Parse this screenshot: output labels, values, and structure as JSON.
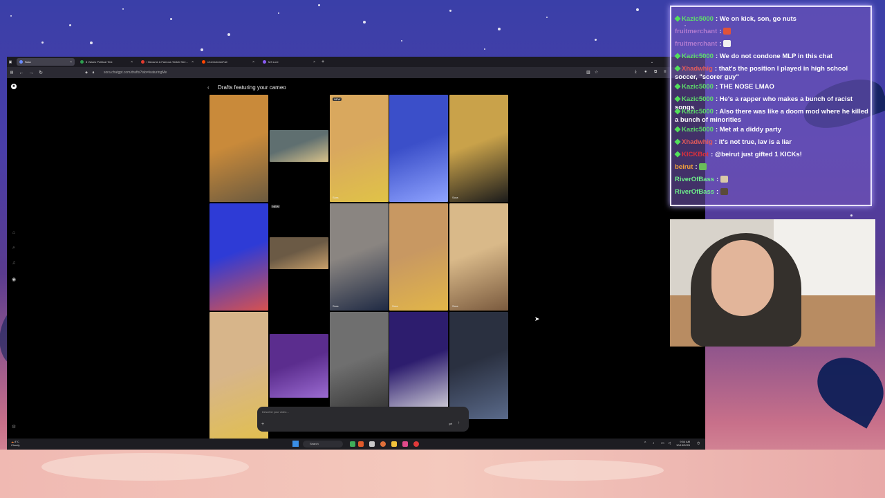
{
  "browser": {
    "tabs": [
      {
        "label": "Sora",
        "color": "#6b8cff",
        "active": true
      },
      {
        "label": "8 Values Political Test",
        "color": "#2e9e4f",
        "active": false
      },
      {
        "label": "I Became A Famous Twitch Stre...",
        "color": "#e23b2f",
        "active": false
      },
      {
        "label": "r/LivestreamFail",
        "color": "#ff4500",
        "active": false
      },
      {
        "label": "M3 Lore",
        "color": "#8b5cf6",
        "active": false
      }
    ],
    "new_tab": "+",
    "url": "sora.chatgpt.com/drafts?tab=featuringMe"
  },
  "sora": {
    "back": "‹",
    "title": "Drafts featuring your cameo",
    "sora_label": "Sora",
    "new_label": "NEW",
    "prompt_placeholder": "Describe your video...",
    "prompt_plus": "+",
    "prompt_settings": "⇌",
    "prompt_send": "↑",
    "thumbs": [
      {
        "colors": [
          "#c98a3a",
          "#6b5a3f"
        ],
        "new": false,
        "sora": false
      },
      {
        "colors": [
          "#5f6f70",
          "#d8c28a"
        ],
        "new": false,
        "sora": false
      },
      {
        "colors": [
          "#d9a85e",
          "#e0c347"
        ],
        "new": true,
        "sora": true
      },
      {
        "colors": [
          "#3b4fc9",
          "#8fa3ff"
        ],
        "new": false,
        "sora": false
      },
      {
        "colors": [
          "#c9a24a",
          "#1b1b1b"
        ],
        "new": false,
        "sora": true
      },
      {
        "colors": [
          "#2e3bd6",
          "#d8524f"
        ],
        "new": false,
        "sora": false
      },
      {
        "colors": [
          "#6b5a45",
          "#c9a06a"
        ],
        "new": true,
        "sora": false
      },
      {
        "colors": [
          "#8a8581",
          "#1f2a44"
        ],
        "new": false,
        "sora": true
      },
      {
        "colors": [
          "#c89862",
          "#e2b648"
        ],
        "new": false,
        "sora": true
      },
      {
        "colors": [
          "#d9b989",
          "#7a5a3e"
        ],
        "new": false,
        "sora": true
      },
      {
        "colors": [
          "#d7b58a",
          "#e2c04c"
        ],
        "new": false,
        "sora": true
      },
      {
        "colors": [
          "#5b2d8e",
          "#9b6bd1"
        ],
        "new": false,
        "sora": false
      },
      {
        "colors": [
          "#6f6f6f",
          "#2e2e2e"
        ],
        "new": false,
        "sora": false
      },
      {
        "colors": [
          "#2d1d6e",
          "#e8e8e8"
        ],
        "new": false,
        "sora": false
      },
      {
        "colors": [
          "#2a3040",
          "#5a6a8a"
        ],
        "new": false,
        "sora": false
      }
    ]
  },
  "taskbar": {
    "weather_temp": "8°C",
    "weather_desc": "Cloudy",
    "search": "Search",
    "time": "9:54 AM",
    "date": "10/15/2025"
  },
  "chat": {
    "messages": [
      {
        "user": "Kazic5000",
        "user_color": "#5ee06a",
        "badge": true,
        "text": "We on kick, son, go nuts"
      },
      {
        "user": "fruitmerchant",
        "user_color": "#b07bd0",
        "badge": false,
        "text": "",
        "emote": "#e0533a"
      },
      {
        "user": "fruitmerchant",
        "user_color": "#b07bd0",
        "badge": false,
        "text": "",
        "emote": "#f0f0f0"
      },
      {
        "user": "Kazic5000",
        "user_color": "#5ee06a",
        "badge": true,
        "text": "We do not condone MLP in this chat"
      },
      {
        "user": "Xhadwhig",
        "user_color": "#e05a5a",
        "badge": true,
        "text": "that's the position I played in high school soccer, \"scorer guy\""
      },
      {
        "user": "Kazic5000",
        "user_color": "#5ee06a",
        "badge": true,
        "text": "THE NOSE LMAO"
      },
      {
        "user": "Kazic5000",
        "user_color": "#5ee06a",
        "badge": true,
        "text": "He's a rapper who makes a bunch of racist songs"
      },
      {
        "user": "Kazic5000",
        "user_color": "#5ee06a",
        "badge": true,
        "text": "Also there was like a doom mod where he killed a bunch of minorities"
      },
      {
        "user": "Kazic5000",
        "user_color": "#5ee06a",
        "badge": true,
        "text": "Met at a diddy party"
      },
      {
        "user": "Xhadwhig",
        "user_color": "#e05a5a",
        "badge": true,
        "text": "it's not true, lav is a liar"
      },
      {
        "user": "KICKBot",
        "user_color": "#e0303a",
        "badge": true,
        "text": "@beirut just gifted 1 KICKs!"
      },
      {
        "user": "beirut",
        "user_color": "#f4a23a",
        "badge": false,
        "text": "",
        "emote": "#6abd5a"
      },
      {
        "user": "RiverOfBass",
        "user_color": "#6ef08a",
        "badge": false,
        "text": "",
        "emote": "#d9c9a8"
      },
      {
        "user": "RiverOfBass",
        "user_color": "#6ef08a",
        "badge": false,
        "text": "",
        "emote": "#5a4a3a"
      }
    ]
  },
  "colors": {
    "background_top": "#3a3fa8",
    "background_bottom": "#e2a3a4",
    "chat_border": "#e9e4ff"
  }
}
